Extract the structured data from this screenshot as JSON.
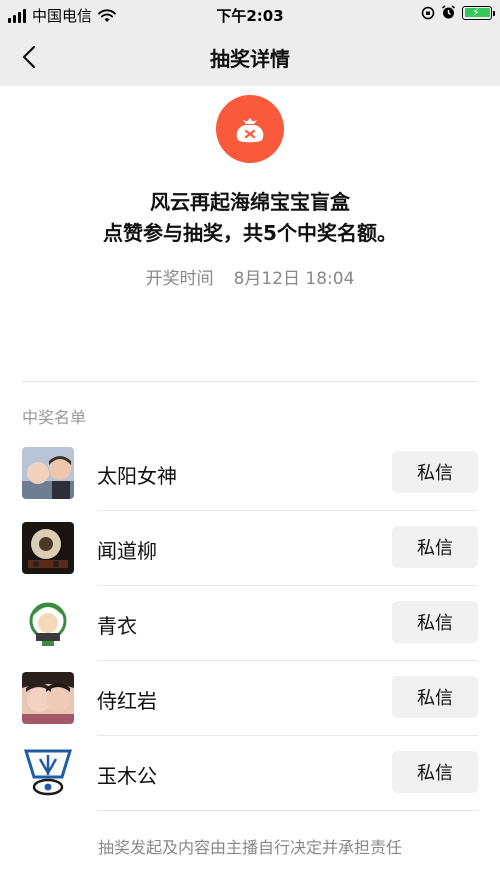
{
  "status": {
    "carrier": "中国电信",
    "time": "下午2:03"
  },
  "nav": {
    "title": "抽奖详情"
  },
  "lottery": {
    "icon": "gift-bag-icon",
    "accent": "#fa5a3c",
    "title_line1": "风云再起海绵宝宝盲盒",
    "title_line2": "点赞参与抽奖，共5个中奖名额。",
    "draw_time_label": "开奖时间",
    "draw_time_value": "8月12日 18:04"
  },
  "winners": {
    "title": "中奖名单",
    "button_label": "私信",
    "items": [
      {
        "name": "太阳女神"
      },
      {
        "name": "闻道柳"
      },
      {
        "name": "青衣"
      },
      {
        "name": "侍红岩"
      },
      {
        "name": "玉木公"
      }
    ]
  },
  "footer": {
    "disclaimer": "抽奖发起及内容由主播自行决定并承担责任"
  }
}
